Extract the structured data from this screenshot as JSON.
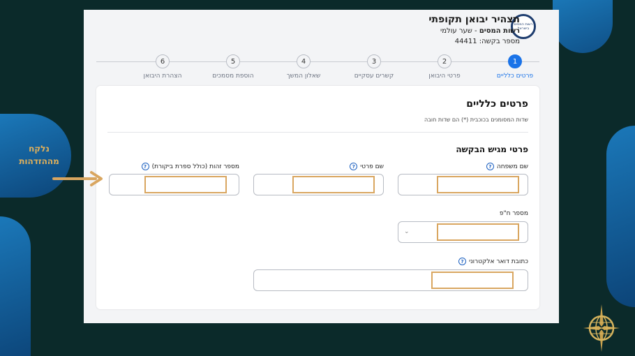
{
  "app": {
    "title": "תצהיר יבואן תקופתי",
    "subtitle_bold": "רשות המסים",
    "subtitle_rest": " - שער עולמי",
    "request_label": "מספר בקשה:",
    "request_number": "44411",
    "logo_text": "רשות המסים בישראל"
  },
  "steps": [
    {
      "num": "1",
      "label": "פרטים כלליים",
      "active": true
    },
    {
      "num": "2",
      "label": "פרטי היבואן",
      "active": false
    },
    {
      "num": "3",
      "label": "קשרים עסקיים",
      "active": false
    },
    {
      "num": "4",
      "label": "שאלון המשך",
      "active": false
    },
    {
      "num": "5",
      "label": "הוספת מסמכים",
      "active": false
    },
    {
      "num": "6",
      "label": "הצהרת היבואן",
      "active": false
    }
  ],
  "form": {
    "section_title": "פרטים כלליים",
    "required_note": "שדות המסומנים בכוכבית (*) הם שדות חובה",
    "subsection_title": "פרטי מגיש הבקשה",
    "fields": {
      "last_name": "שם משפחה",
      "first_name": "שם פרטי",
      "id_number": "מספר זהות (כולל ספרת ביקורת)",
      "company_number": "מספר ח\"פ",
      "email": "כתובת דואר אלקטרוני"
    },
    "help_glyph": "?"
  },
  "callout": {
    "line1": "נלקח",
    "line2": "מההזדהות"
  },
  "colors": {
    "accent": "#1a73e8",
    "highlight": "#d9a660",
    "background": "#0b2a2a"
  },
  "icons": {
    "help": "question-circle-icon",
    "dropdown": "chevron-down-icon",
    "arrow": "arrow-right-icon"
  }
}
